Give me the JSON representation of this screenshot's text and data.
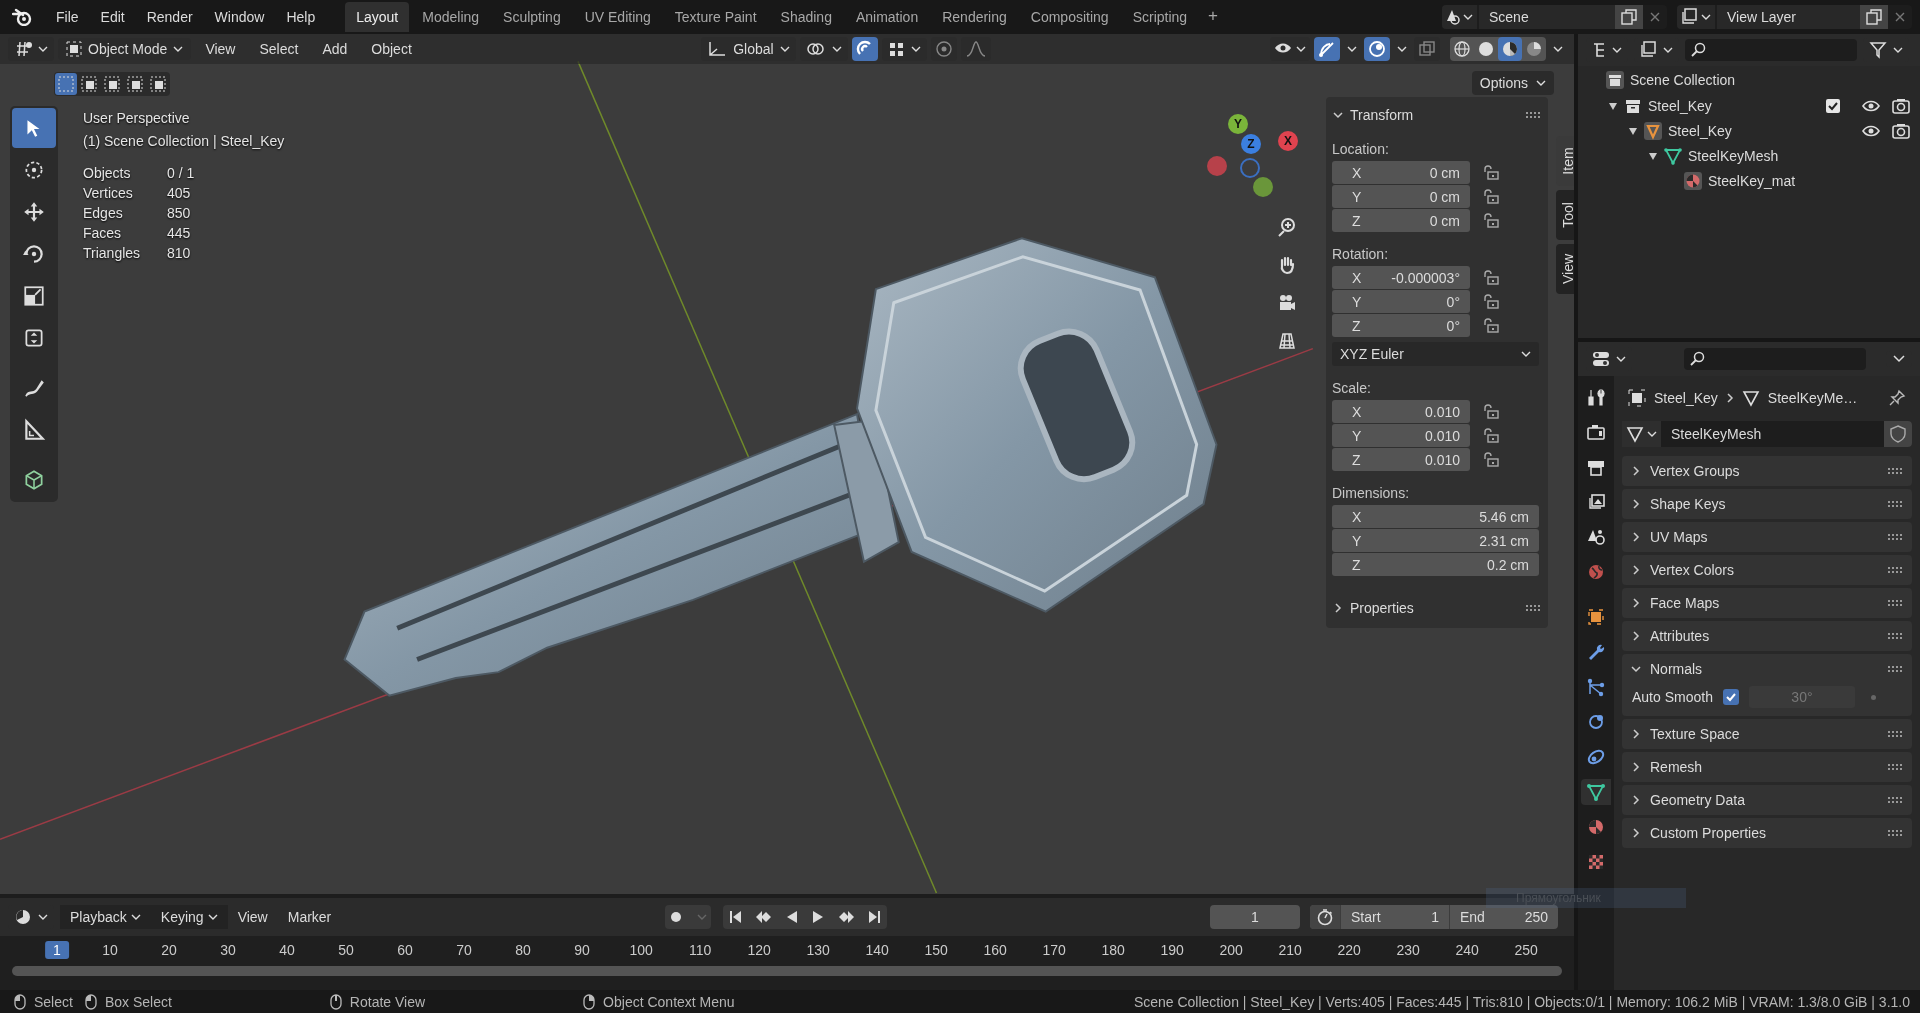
{
  "topbar": {
    "menus": [
      "File",
      "Edit",
      "Render",
      "Window",
      "Help"
    ],
    "workspaces": [
      {
        "label": "Layout",
        "selected": true
      },
      {
        "label": "Modeling",
        "selected": false
      },
      {
        "label": "Sculpting",
        "selected": false
      },
      {
        "label": "UV Editing",
        "selected": false
      },
      {
        "label": "Texture Paint",
        "selected": false
      },
      {
        "label": "Shading",
        "selected": false
      },
      {
        "label": "Animation",
        "selected": false
      },
      {
        "label": "Rendering",
        "selected": false
      },
      {
        "label": "Compositing",
        "selected": false
      },
      {
        "label": "Scripting",
        "selected": false
      }
    ],
    "add_tab": "+",
    "scene": "Scene",
    "view_layer": "View Layer"
  },
  "viewport": {
    "mode": "Object Mode",
    "menus": [
      "View",
      "Select",
      "Add",
      "Object"
    ],
    "orientation": "Global",
    "snap_on": true,
    "proportional_on": false,
    "options": "Options",
    "toggles": [
      {
        "kind": "gizmos",
        "on": true
      },
      {
        "kind": "overlays",
        "on": true
      },
      {
        "kind": "xray",
        "on": false
      }
    ],
    "shading": [
      {
        "kind": "wireframe",
        "selected": false
      },
      {
        "kind": "solid",
        "selected": false
      },
      {
        "kind": "material",
        "selected": true
      },
      {
        "kind": "rendered",
        "selected": false
      }
    ],
    "select_modes": [
      {
        "selected": true
      },
      {
        "selected": false
      },
      {
        "selected": false
      },
      {
        "selected": false
      },
      {
        "selected": false
      }
    ],
    "title": "User Perspective",
    "subtitle": "(1) Scene Collection | Steel_Key",
    "stats": [
      {
        "label": "Objects",
        "value": "0 / 1"
      },
      {
        "label": "Vertices",
        "value": "405"
      },
      {
        "label": "Edges",
        "value": "850"
      },
      {
        "label": "Faces",
        "value": "445"
      },
      {
        "label": "Triangles",
        "value": "810"
      }
    ],
    "tools": [
      {
        "kind": "select",
        "selected": true
      },
      {
        "kind": "cursor",
        "selected": false
      },
      {
        "kind": "move",
        "selected": false
      },
      {
        "kind": "rotate",
        "selected": false
      },
      {
        "kind": "scale",
        "selected": false
      },
      {
        "kind": "transform",
        "selected": false
      },
      {
        "kind": "annotate",
        "selected": false
      },
      {
        "kind": "measure",
        "selected": false
      },
      {
        "kind": "add-cube",
        "selected": false
      }
    ],
    "gizmo": {
      "x": "X",
      "y": "Y",
      "z": "Z"
    },
    "overlay_label": "Прямоугольник"
  },
  "sidebar": {
    "tabs": [
      {
        "label": "Item",
        "selected": true
      },
      {
        "label": "Tool",
        "selected": false
      },
      {
        "label": "View",
        "selected": false
      }
    ],
    "transform": {
      "title": "Transform",
      "expanded": true,
      "groups": [
        {
          "label": "Location:",
          "lockable": true,
          "fields": [
            {
              "axis": "X",
              "value": "0 cm"
            },
            {
              "axis": "Y",
              "value": "0 cm"
            },
            {
              "axis": "Z",
              "value": "0 cm"
            }
          ]
        },
        {
          "label": "Rotation:",
          "lockable": true,
          "fields": [
            {
              "axis": "X",
              "value": "-0.000003°"
            },
            {
              "axis": "Y",
              "value": "0°"
            },
            {
              "axis": "Z",
              "value": "0°"
            }
          ],
          "mode": "XYZ Euler"
        },
        {
          "label": "Scale:",
          "lockable": true,
          "fields": [
            {
              "axis": "X",
              "value": "0.010"
            },
            {
              "axis": "Y",
              "value": "0.010"
            },
            {
              "axis": "Z",
              "value": "0.010"
            }
          ]
        },
        {
          "label": "Dimensions:",
          "lockable": false,
          "fields": [
            {
              "axis": "X",
              "value": "5.46 cm"
            },
            {
              "axis": "Y",
              "value": "2.31 cm"
            },
            {
              "axis": "Z",
              "value": "0.2 cm"
            }
          ]
        }
      ]
    },
    "properties": {
      "title": "Properties",
      "expanded": false
    }
  },
  "outliner": {
    "root": "Scene Collection",
    "items": [
      {
        "label": "Steel_Key",
        "kind": "collection",
        "expanded": true,
        "checked": true,
        "children": [
          {
            "label": "Steel_Key",
            "kind": "object",
            "expanded": true,
            "children": [
              {
                "label": "SteelKeyMesh",
                "kind": "mesh",
                "expanded": true,
                "children": [
                  {
                    "label": "SteelKey_mat",
                    "kind": "material"
                  }
                ]
              }
            ]
          }
        ]
      }
    ]
  },
  "properties": {
    "tabs": [
      {
        "kind": "tool",
        "selected": false
      },
      {
        "kind": "render",
        "selected": false
      },
      {
        "kind": "output",
        "selected": false
      },
      {
        "kind": "view-layer",
        "selected": false
      },
      {
        "kind": "scene",
        "selected": false
      },
      {
        "kind": "world",
        "selected": false
      },
      {
        "kind": "object",
        "selected": false
      },
      {
        "kind": "modifier",
        "selected": false
      },
      {
        "kind": "particles",
        "selected": false
      },
      {
        "kind": "physics",
        "selected": false
      },
      {
        "kind": "constraints",
        "selected": false
      },
      {
        "kind": "data",
        "selected": true
      },
      {
        "kind": "material",
        "selected": false
      },
      {
        "kind": "texture",
        "selected": false
      }
    ],
    "breadcrumb": [
      "Steel_Key",
      "SteelKeyMe…"
    ],
    "mesh_name": "SteelKeyMesh",
    "panels": [
      {
        "label": "Vertex Groups",
        "expanded": false
      },
      {
        "label": "Shape Keys",
        "expanded": false
      },
      {
        "label": "UV Maps",
        "expanded": false
      },
      {
        "label": "Vertex Colors",
        "expanded": false
      },
      {
        "label": "Face Maps",
        "expanded": false
      },
      {
        "label": "Attributes",
        "expanded": false
      },
      {
        "label": "Normals",
        "expanded": true,
        "auto_smooth": {
          "label": "Auto Smooth",
          "checked": true,
          "angle": "30°"
        }
      },
      {
        "label": "Texture Space",
        "expanded": false
      },
      {
        "label": "Remesh",
        "expanded": false
      },
      {
        "label": "Geometry Data",
        "expanded": false
      },
      {
        "label": "Custom Properties",
        "expanded": false
      }
    ]
  },
  "timeline": {
    "menus": [
      {
        "label": "Playback",
        "dropdown": true
      },
      {
        "label": "Keying",
        "dropdown": true
      },
      {
        "label": "View",
        "dropdown": false
      },
      {
        "label": "Marker",
        "dropdown": false
      }
    ],
    "current_frame": "1",
    "start_label": "Start",
    "start": "1",
    "end_label": "End",
    "end": "250",
    "ruler": [
      {
        "label": "1",
        "selected": true
      },
      {
        "label": "10",
        "selected": false
      },
      {
        "label": "20",
        "selected": false
      },
      {
        "label": "30",
        "selected": false
      },
      {
        "label": "40",
        "selected": false
      },
      {
        "label": "50",
        "selected": false
      },
      {
        "label": "60",
        "selected": false
      },
      {
        "label": "70",
        "selected": false
      },
      {
        "label": "80",
        "selected": false
      },
      {
        "label": "90",
        "selected": false
      },
      {
        "label": "100",
        "selected": false
      },
      {
        "label": "110",
        "selected": false
      },
      {
        "label": "120",
        "selected": false
      },
      {
        "label": "130",
        "selected": false
      },
      {
        "label": "140",
        "selected": false
      },
      {
        "label": "150",
        "selected": false
      },
      {
        "label": "160",
        "selected": false
      },
      {
        "label": "170",
        "selected": false
      },
      {
        "label": "180",
        "selected": false
      },
      {
        "label": "190",
        "selected": false
      },
      {
        "label": "200",
        "selected": false
      },
      {
        "label": "210",
        "selected": false
      },
      {
        "label": "220",
        "selected": false
      },
      {
        "label": "230",
        "selected": false
      },
      {
        "label": "240",
        "selected": false
      },
      {
        "label": "250",
        "selected": false
      }
    ]
  },
  "status_bar": {
    "hints": [
      "Select",
      "Box Select",
      "Rotate View",
      "Object Context Menu"
    ],
    "info": "Scene Collection | Steel_Key | Verts:405 | Faces:445 | Tris:810 | Objects:0/1 | Memory: 106.2 MiB | VRAM: 1.3/8.0 GiB | 3.1.0"
  }
}
